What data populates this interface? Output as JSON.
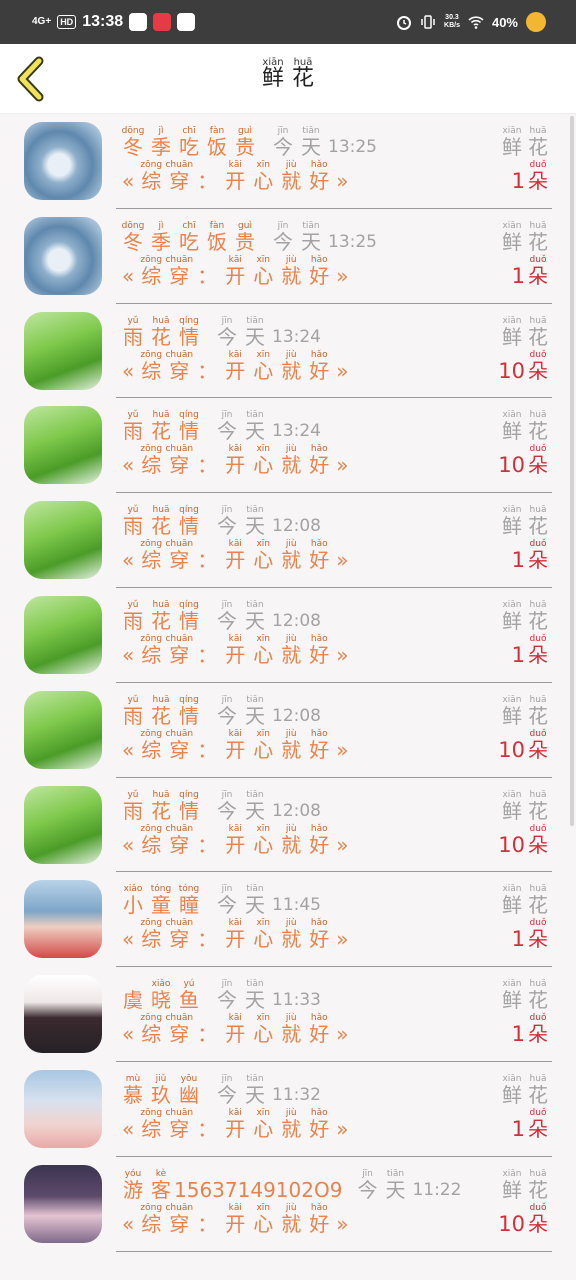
{
  "status_bar": {
    "network": "4G+",
    "hd": "HD",
    "time": "13:38",
    "net_speed_value": "30.3",
    "net_speed_unit": "KB/s",
    "battery": "40%"
  },
  "header": {
    "title": [
      {
        "py": "xiān",
        "hz": "鲜"
      },
      {
        "py": "huā",
        "hz": "花"
      }
    ]
  },
  "labels": {
    "today": [
      {
        "py": "jīn",
        "hz": "今"
      },
      {
        "py": "tiān",
        "hz": "天"
      }
    ],
    "flower": [
      {
        "py": "xiān",
        "hz": "鲜"
      },
      {
        "py": "huā",
        "hz": "花"
      }
    ],
    "unit": {
      "py": "duǒ",
      "hz": "朵"
    },
    "message": [
      {
        "py": "zōng",
        "hz": "综"
      },
      {
        "py": "chuān",
        "hz": "穿"
      },
      {
        "py": "",
        "hz": "："
      },
      {
        "py": "kāi",
        "hz": "开"
      },
      {
        "py": "xīn",
        "hz": "心"
      },
      {
        "py": "jiù",
        "hz": "就"
      },
      {
        "py": "hǎo",
        "hz": "好"
      }
    ],
    "quote_open": "«",
    "quote_close": "»"
  },
  "rows": [
    {
      "avatar": "av-ice",
      "name": [
        {
          "py": "dōng",
          "hz": "冬"
        },
        {
          "py": "jì",
          "hz": "季"
        },
        {
          "py": "chī",
          "hz": "吃"
        },
        {
          "py": "fàn",
          "hz": "饭"
        },
        {
          "py": "guì",
          "hz": "贵"
        }
      ],
      "name_num": "",
      "time": "13:25",
      "count": "1"
    },
    {
      "avatar": "av-ice",
      "name": [
        {
          "py": "dōng",
          "hz": "冬"
        },
        {
          "py": "jì",
          "hz": "季"
        },
        {
          "py": "chī",
          "hz": "吃"
        },
        {
          "py": "fàn",
          "hz": "饭"
        },
        {
          "py": "guì",
          "hz": "贵"
        }
      ],
      "name_num": "",
      "time": "13:25",
      "count": "1"
    },
    {
      "avatar": "av-leaf",
      "name": [
        {
          "py": "yǔ",
          "hz": "雨"
        },
        {
          "py": "huā",
          "hz": "花"
        },
        {
          "py": "qíng",
          "hz": "情"
        }
      ],
      "name_num": "",
      "time": "13:24",
      "count": "10"
    },
    {
      "avatar": "av-leaf",
      "name": [
        {
          "py": "yǔ",
          "hz": "雨"
        },
        {
          "py": "huā",
          "hz": "花"
        },
        {
          "py": "qíng",
          "hz": "情"
        }
      ],
      "name_num": "",
      "time": "13:24",
      "count": "10"
    },
    {
      "avatar": "av-leaf",
      "name": [
        {
          "py": "yǔ",
          "hz": "雨"
        },
        {
          "py": "huā",
          "hz": "花"
        },
        {
          "py": "qíng",
          "hz": "情"
        }
      ],
      "name_num": "",
      "time": "12:08",
      "count": "1"
    },
    {
      "avatar": "av-leaf",
      "name": [
        {
          "py": "yǔ",
          "hz": "雨"
        },
        {
          "py": "huā",
          "hz": "花"
        },
        {
          "py": "qíng",
          "hz": "情"
        }
      ],
      "name_num": "",
      "time": "12:08",
      "count": "1"
    },
    {
      "avatar": "av-leaf",
      "name": [
        {
          "py": "yǔ",
          "hz": "雨"
        },
        {
          "py": "huā",
          "hz": "花"
        },
        {
          "py": "qíng",
          "hz": "情"
        }
      ],
      "name_num": "",
      "time": "12:08",
      "count": "10"
    },
    {
      "avatar": "av-leaf",
      "name": [
        {
          "py": "yǔ",
          "hz": "雨"
        },
        {
          "py": "huā",
          "hz": "花"
        },
        {
          "py": "qíng",
          "hz": "情"
        }
      ],
      "name_num": "",
      "time": "12:08",
      "count": "10"
    },
    {
      "avatar": "av-girl1",
      "name": [
        {
          "py": "xiǎo",
          "hz": "小"
        },
        {
          "py": "tóng",
          "hz": "童"
        },
        {
          "py": "tóng",
          "hz": "瞳"
        }
      ],
      "name_num": "",
      "time": "11:45",
      "count": "1"
    },
    {
      "avatar": "av-girl2",
      "name": [
        {
          "py": "",
          "hz": "虞"
        },
        {
          "py": "xiǎo",
          "hz": "晓"
        },
        {
          "py": "yú",
          "hz": "鱼"
        }
      ],
      "name_num": "",
      "time": "11:33",
      "count": "1"
    },
    {
      "avatar": "av-girl3",
      "name": [
        {
          "py": "mù",
          "hz": "慕"
        },
        {
          "py": "jiǔ",
          "hz": "玖"
        },
        {
          "py": "yōu",
          "hz": "幽"
        }
      ],
      "name_num": "",
      "time": "11:32",
      "count": "1"
    },
    {
      "avatar": "av-girl4",
      "name": [
        {
          "py": "yóu",
          "hz": "游"
        },
        {
          "py": "kè",
          "hz": "客"
        }
      ],
      "name_num": "15637149102O9",
      "time": "11:22",
      "count": "10"
    }
  ]
}
